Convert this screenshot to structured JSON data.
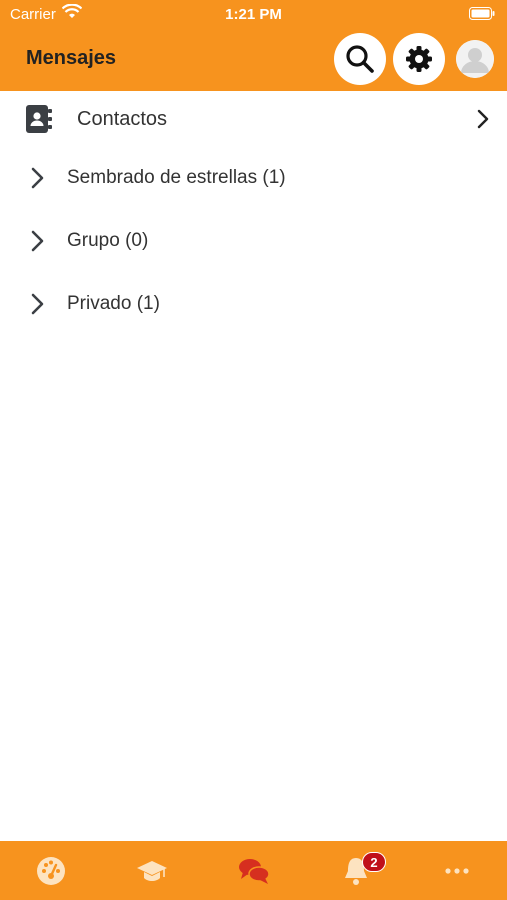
{
  "status_bar": {
    "carrier": "Carrier",
    "time": "1:21 PM"
  },
  "header": {
    "title": "Mensajes"
  },
  "contacts": {
    "label": "Contactos"
  },
  "groups": [
    {
      "label": "Sembrado de estrellas (1)"
    },
    {
      "label": "Grupo (0)"
    },
    {
      "label": "Privado (1)"
    }
  ],
  "tabs": [
    {
      "icon": "dashboard-icon"
    },
    {
      "icon": "graduation-cap-icon"
    },
    {
      "icon": "chat-bubbles-icon",
      "active": true
    },
    {
      "icon": "bell-icon",
      "badge": "2"
    },
    {
      "icon": "more-icon"
    }
  ],
  "colors": {
    "brand": "#f7931e",
    "active_tab": "#d62f1f",
    "inactive_tab": "#fde3c0",
    "badge": "#c0101a"
  }
}
